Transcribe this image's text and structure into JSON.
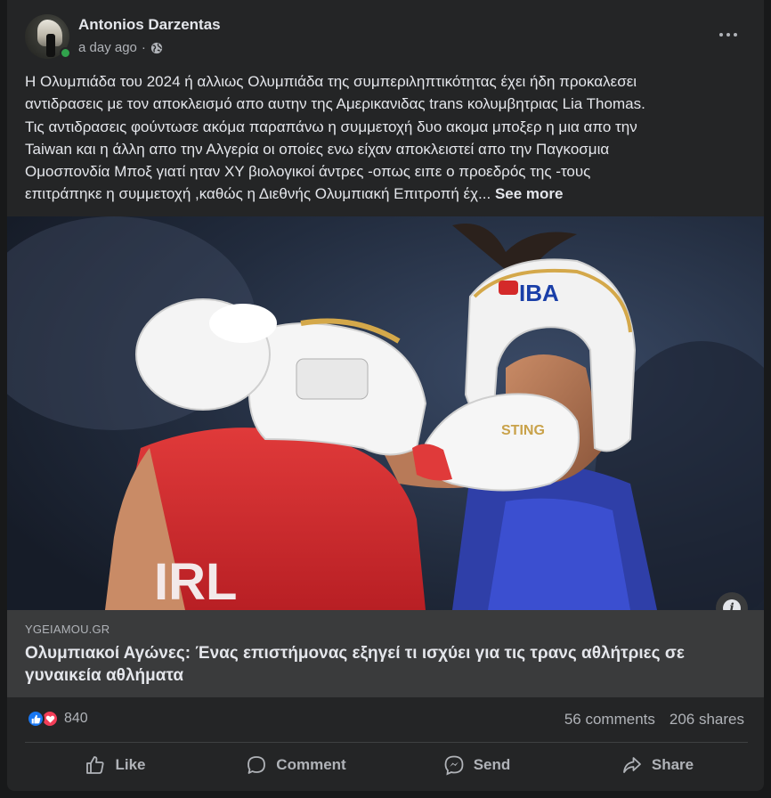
{
  "post": {
    "author": "Antonios Darzentas",
    "timestamp": "a day ago",
    "separator": "·",
    "audience_icon": "globe-icon",
    "text_lines": [
      "Η Ολυμπιάδα του 2024 ή αλλιως Ολυμπιάδα της συμπεριληπτικότητας έχει ήδη προκαλεσει",
      "αντιδρασεις με τον αποκλεισμό απο αυτην της Αμερικανιδας trans κολυμβητριας Lia Thomas.",
      "Τις αντιδρασεις φούντωσε ακόμα παραπάνω η συμμετοχή δυο ακομα μποξερ η μια απο την",
      "Taiwan και η άλλη απο την Αλγερία οι οποίες ενω είχαν αποκλειστεί απο την Παγκοσμια",
      "Ομοσπονδία Μποξ γιατί ηταν XY βιολογικοί άντρες -οπως ειπε ο προεδρός της -τους",
      "επιτράπηκε η συμμετοχή ,καθώς η Διεθνής Ολυμπιακή Επιτροπή έχ..."
    ],
    "see_more": "See more"
  },
  "image": {
    "helmet_brand": "IBA",
    "glove_brand": "STING",
    "jersey_text": "IRL"
  },
  "link": {
    "domain": "YGEIAMOU.GR",
    "title": "Ολυμπιακοί Αγώνες: Ένας επιστήμονας εξηγεί τι ισχύει για τις τρανς αθλήτριες σε γυναικεία αθλήματα"
  },
  "stats": {
    "reaction_count": "840",
    "comments": "56 comments",
    "shares": "206 shares"
  },
  "actions": {
    "like": "Like",
    "comment": "Comment",
    "send": "Send",
    "share": "Share"
  },
  "colors": {
    "card_bg": "#242526",
    "link_bg": "#3a3b3c",
    "like_blue": "#1877f2",
    "love_red": "#f33e58",
    "online_green": "#31a24c"
  }
}
